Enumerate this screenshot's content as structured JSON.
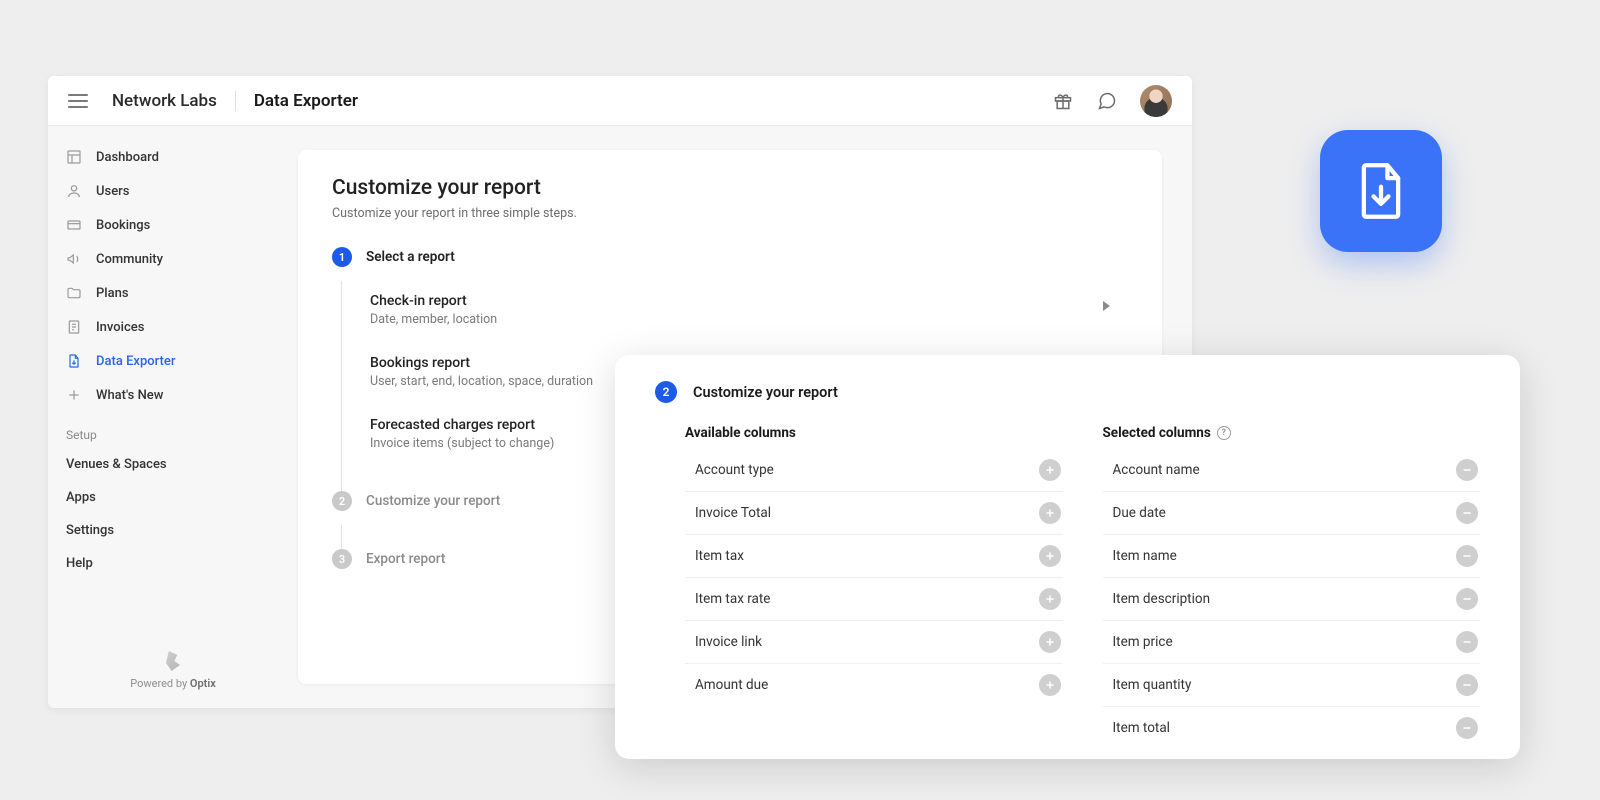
{
  "header": {
    "org": "Network Labs",
    "page": "Data Exporter"
  },
  "sidebar": {
    "nav": [
      {
        "label": "Dashboard",
        "icon": "dashboard"
      },
      {
        "label": "Users",
        "icon": "user"
      },
      {
        "label": "Bookings",
        "icon": "card"
      },
      {
        "label": "Community",
        "icon": "megaphone"
      },
      {
        "label": "Plans",
        "icon": "folder"
      },
      {
        "label": "Invoices",
        "icon": "invoice"
      },
      {
        "label": "Data Exporter",
        "icon": "download-doc",
        "active": true
      },
      {
        "label": "What's New",
        "icon": "plus"
      }
    ],
    "setup_label": "Setup",
    "setup": [
      "Venues & Spaces",
      "Apps",
      "Settings",
      "Help"
    ],
    "powered_prefix": "Powered by ",
    "powered_brand": "Optix"
  },
  "card": {
    "title": "Customize your report",
    "subtitle": "Customize your report in three simple steps.",
    "step1": {
      "num": "1",
      "label": "Select a report"
    },
    "reports": [
      {
        "name": "Check-in report",
        "desc": "Date, member, location"
      },
      {
        "name": "Bookings report",
        "desc": "User, start, end, location, space, duration"
      },
      {
        "name": "Forecasted charges report",
        "desc": "Invoice items (subject to change)"
      }
    ],
    "step2": {
      "num": "2",
      "label": "Customize your report"
    },
    "step3": {
      "num": "3",
      "label": "Export report"
    }
  },
  "panel": {
    "step_num": "2",
    "step_label": "Customize your report",
    "available_label": "Available columns",
    "selected_label": "Selected columns",
    "available": [
      "Account type",
      "Invoice Total",
      "Item tax",
      "Item tax rate",
      "Invoice link",
      "Amount due"
    ],
    "selected": [
      "Account name",
      "Due date",
      "Item name",
      "Item description",
      "Item price",
      "Item quantity",
      "Item total"
    ]
  }
}
